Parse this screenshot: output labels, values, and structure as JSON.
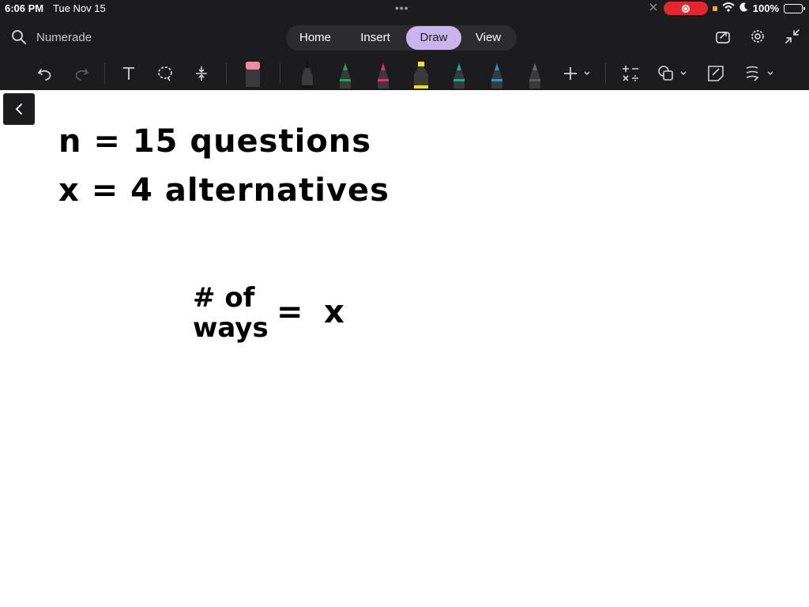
{
  "status": {
    "time": "6:06 PM",
    "date": "Tue Nov 15",
    "battery": "100%",
    "dots": "•••"
  },
  "header": {
    "search_label": "Numerade",
    "tabs": [
      {
        "label": "Home"
      },
      {
        "label": "Insert"
      },
      {
        "label": "Draw",
        "active": true
      },
      {
        "label": "View"
      }
    ]
  },
  "toolbar": {
    "tools": [
      "undo-icon",
      "redo-icon",
      "text-tool-icon",
      "lasso-icon",
      "space-insert-icon",
      "eraser-icon",
      "pen-black-icon",
      "pen-green-icon",
      "pen-pink-icon",
      "highlighter-yellow-icon",
      "pen-teal-icon",
      "pen-blue-icon",
      "pen-gray-icon",
      "add-pen-icon",
      "math-icon",
      "shapes-icon",
      "sticky-note-icon",
      "ink-settings-icon"
    ],
    "pen_colors": {
      "black": "#111111",
      "green": "#1fa64a",
      "pink": "#e0306e",
      "yellow": "#f5e400",
      "teal": "#1fa68e",
      "blue": "#2e8fc4",
      "gray": "#5a5a5a"
    }
  },
  "canvas": {
    "line1": "n = 15 questions",
    "line2": "x = 4 alternatives",
    "hash_of": "# of",
    "ways": "ways",
    "equals": "=",
    "x": "x"
  },
  "colors": {
    "bar": "#1c1c1e",
    "active_tab": "#c9b4ec",
    "record": "#e5262e",
    "battery": "#34c759"
  }
}
